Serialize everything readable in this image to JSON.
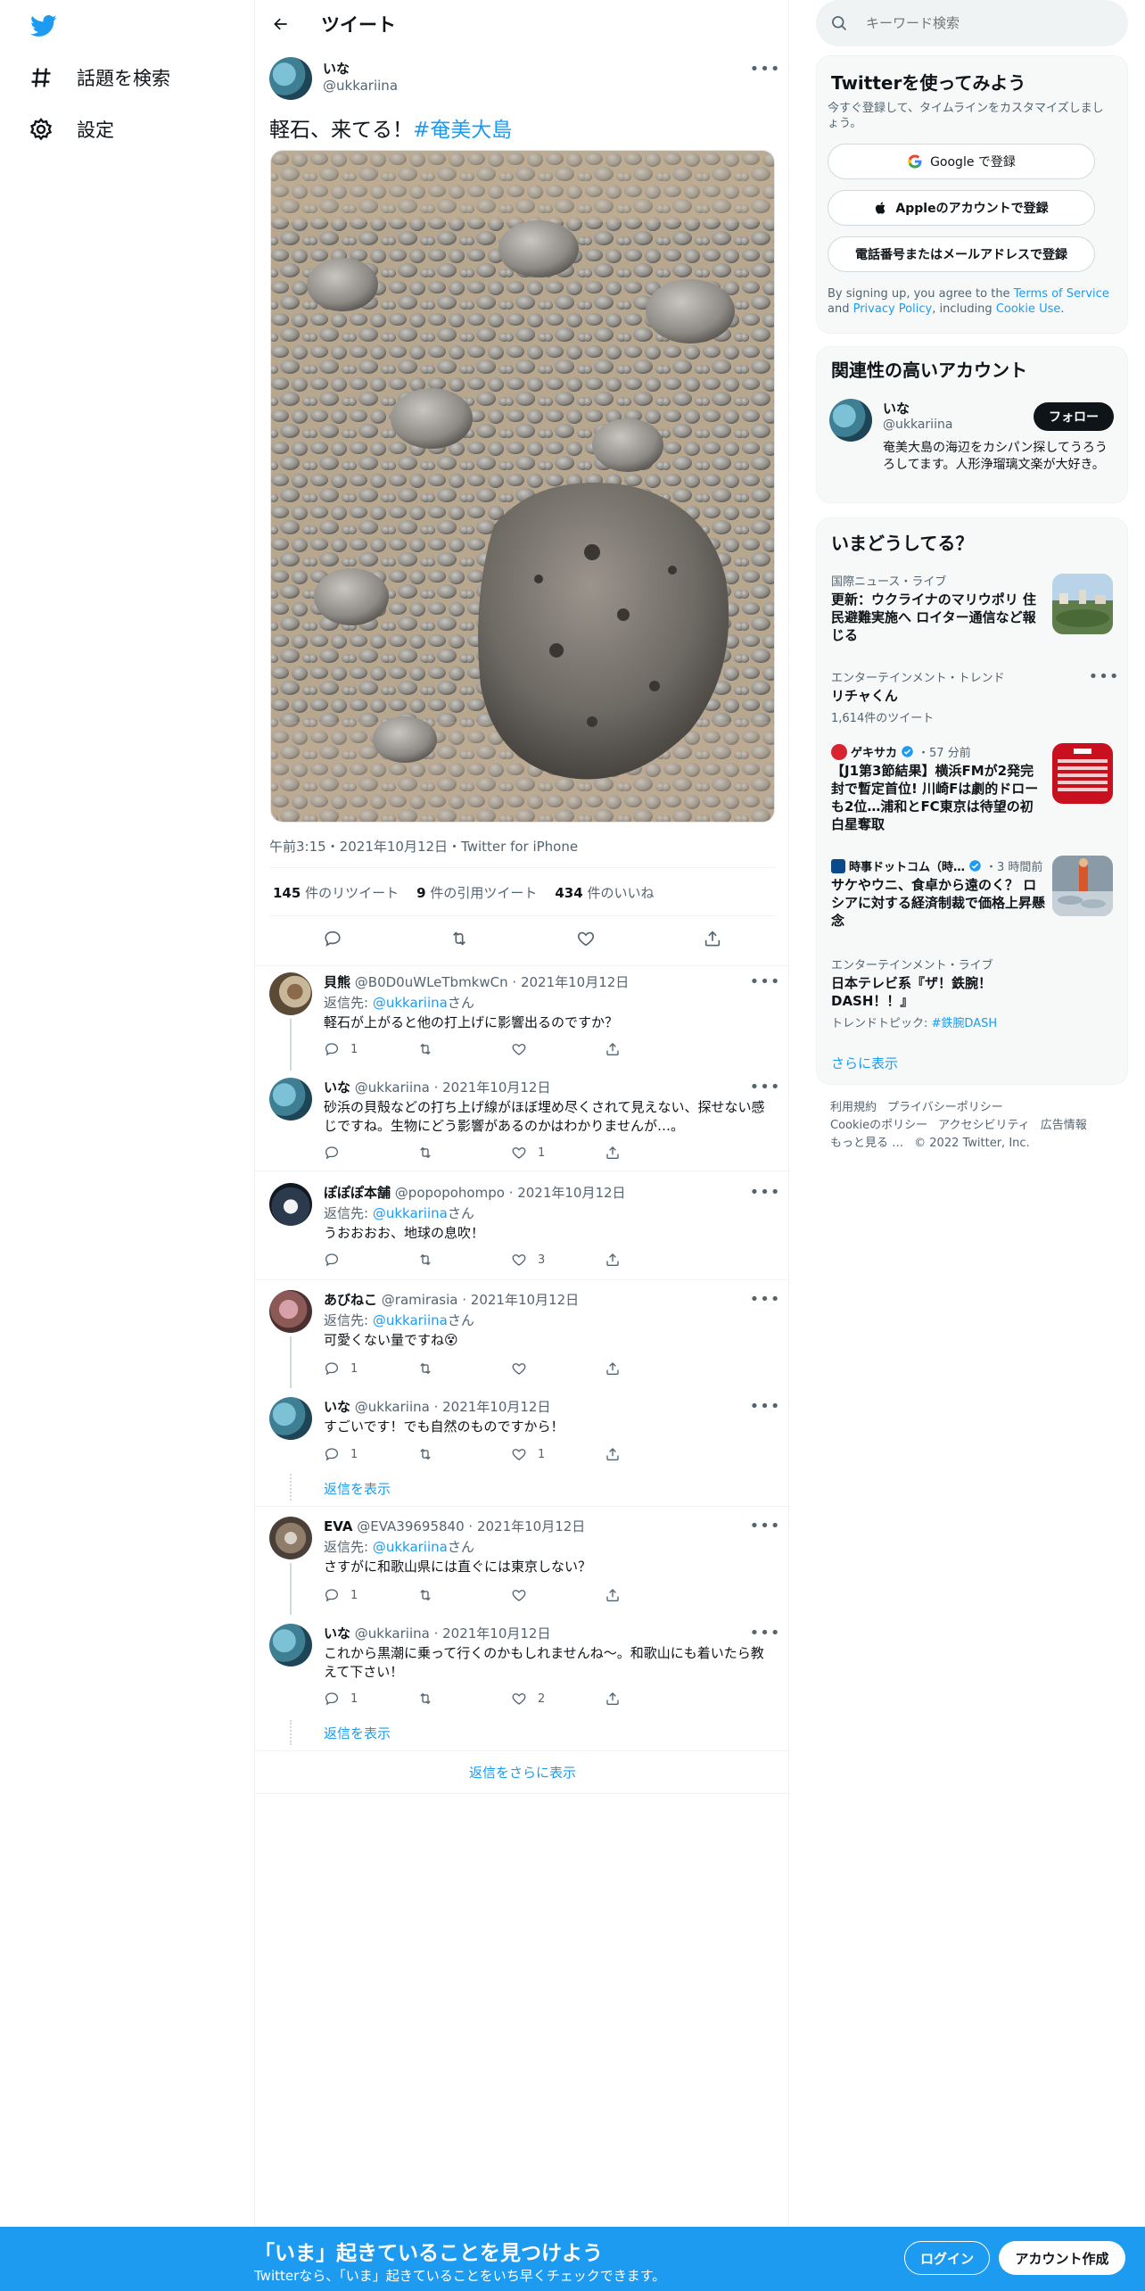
{
  "nav": {
    "explore": "話題を検索",
    "settings": "設定"
  },
  "header": {
    "title": "ツイート"
  },
  "tweet": {
    "name": "いな",
    "handle": "@ukkariina",
    "text": "軽石、来てる！",
    "hashtag": "#奄美大島",
    "meta": "午前3:15・2021年10月12日・Twitter for iPhone",
    "retweets": "145",
    "retweets_label": "件のリツイート",
    "quotes": "9",
    "quotes_label": "件の引用ツイート",
    "likes": "434",
    "likes_label": "件のいいね"
  },
  "replies": [
    {
      "name": "貝熊",
      "handle": "@B0D0uWLeTbmkwCn",
      "date": "2021年10月12日",
      "to_prefix": "返信先: ",
      "to": "@ukkariina",
      "to_suffix": "さん",
      "text": "軽石が上がると他の打上げに影響出るのですか？",
      "reply_count": "1",
      "retweet_count": "",
      "like_count": ""
    },
    {
      "name": "いな",
      "handle": "@ukkariina",
      "date": "2021年10月12日",
      "text": "砂浜の貝殻などの打ち上げ線がほぼ埋め尽くされて見えない、探せない感じですね。生物にどう影響があるのかはわかりませんが…。",
      "reply_count": "",
      "retweet_count": "",
      "like_count": "1"
    },
    {
      "name": "ぽぽぽ本舗",
      "handle": "@popopohompo",
      "date": "2021年10月12日",
      "to_prefix": "返信先: ",
      "to": "@ukkariina",
      "to_suffix": "さん",
      "text": "うおおおお、地球の息吹！",
      "reply_count": "",
      "retweet_count": "",
      "like_count": "3"
    },
    {
      "name": "あびねこ",
      "handle": "@ramirasia",
      "date": "2021年10月12日",
      "to_prefix": "返信先: ",
      "to": "@ukkariina",
      "to_suffix": "さん",
      "text": "可愛くない量ですね😵",
      "reply_count": "1",
      "retweet_count": "",
      "like_count": ""
    },
    {
      "name": "いな",
      "handle": "@ukkariina",
      "date": "2021年10月12日",
      "text": "すごいです！でも自然のものですから！",
      "reply_count": "1",
      "retweet_count": "",
      "like_count": "1"
    },
    {
      "name": "EVA",
      "handle": "@EVA39695840",
      "date": "2021年10月12日",
      "to_prefix": "返信先: ",
      "to": "@ukkariina",
      "to_suffix": "さん",
      "text": "さすがに和歌山県には直ぐには東京しない？",
      "reply_count": "1",
      "retweet_count": "",
      "like_count": ""
    },
    {
      "name": "いな",
      "handle": "@ukkariina",
      "date": "2021年10月12日",
      "text": "これから黒潮に乗って行くのかもしれませんね〜。和歌山にも着いたら教えて下さい！",
      "reply_count": "1",
      "retweet_count": "",
      "like_count": "2"
    }
  ],
  "show_replies": "返信を表示",
  "more_replies": "返信をさらに表示",
  "search": {
    "placeholder": "キーワード検索"
  },
  "signup": {
    "title": "Twitterを使ってみよう",
    "sub": "今すぐ登録して、タイムラインをカスタマイズしましょう。",
    "google": "Google で登録",
    "apple": "Appleのアカウントで登録",
    "phone": "電話番号またはメールアドレスで登録",
    "terms_1": "By signing up, you agree to the ",
    "terms_link": "Terms of Service",
    "terms_2": " and ",
    "privacy_link": "Privacy Policy",
    "terms_3": ", including ",
    "cookie_link": "Cookie Use",
    "terms_4": "."
  },
  "related": {
    "title": "関連性の高いアカウント",
    "name": "いな",
    "handle": "@ukkariina",
    "follow": "フォロー",
    "bio": "奄美大島の海辺をカシパン探してうろうろしてます。人形浄瑠璃文楽が大好き。"
  },
  "trends": {
    "title": "いまどうしてる？",
    "items": [
      {
        "cat": "国際ニュース・ライブ",
        "title": "更新：ウクライナのマリウポリ 住民避難実施へ ロイター通信など報じる"
      },
      {
        "cat": "エンターテインメント・トレンド",
        "title": "リチャくん",
        "sub": "1,614件のツイート"
      },
      {
        "source": "ゲキサカ",
        "time": "・57 分前",
        "title": "【J1第3節結果】横浜FMが2発完封で暫定首位! 川崎Fは劇的ドローも2位…浦和とFC東京は待望の初白星奪取"
      },
      {
        "source": "時事ドットコム（時…",
        "time": "・3 時間前",
        "title": "サケやウニ、食卓から遠のく？ ロシアに対する経済制裁で価格上昇懸念"
      },
      {
        "cat": "エンターテインメント・ライブ",
        "title": "日本テレビ系『ザ！鉄腕！DASH！！』",
        "sub_prefix": "トレンドトピック: ",
        "sub_link": "#鉄腕DASH"
      }
    ],
    "show_more": "さらに表示"
  },
  "footer": {
    "links": [
      "利用規約",
      "プライバシーポリシー",
      "Cookieのポリシー",
      "アクセシビリティ",
      "広告情報",
      "もっと見る …"
    ],
    "copyright": "© 2022 Twitter, Inc."
  },
  "bottombar": {
    "title": "「いま」起きていることを見つけよう",
    "sub": "Twitterなら、「いま」起きていることをいち早くチェックできます。",
    "login": "ログイン",
    "signup": "アカウント作成"
  }
}
